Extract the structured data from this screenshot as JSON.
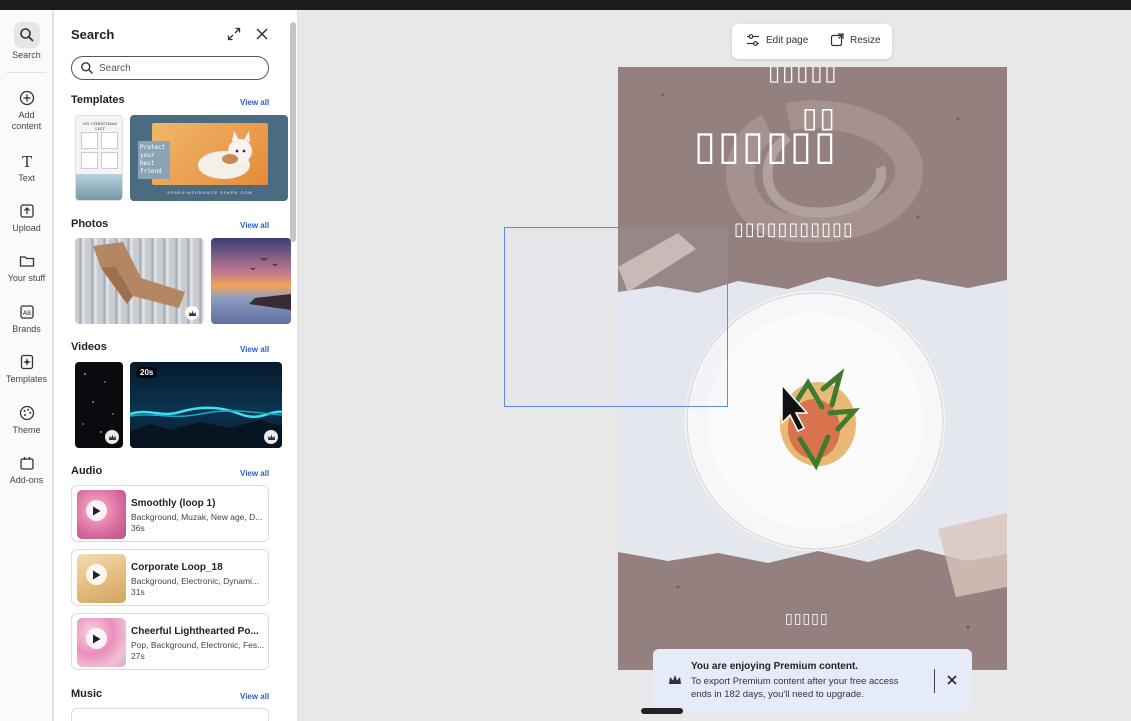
{
  "rail": {
    "items": [
      {
        "label": "Search",
        "icon": "search-icon"
      },
      {
        "label": "Add content",
        "icon": "plus-circle-icon"
      },
      {
        "label": "Text",
        "icon": "text-icon"
      },
      {
        "label": "Upload",
        "icon": "upload-icon"
      },
      {
        "label": "Your stuff",
        "icon": "folder-icon"
      },
      {
        "label": "Brands",
        "icon": "brand-icon"
      },
      {
        "label": "Templates",
        "icon": "templates-icon"
      },
      {
        "label": "Theme",
        "icon": "palette-icon"
      },
      {
        "label": "Add-ons",
        "icon": "addons-icon"
      }
    ]
  },
  "panel": {
    "title": "Search",
    "search_placeholder": "Search",
    "view_all": "View all",
    "sections": {
      "templates": "Templates",
      "photos": "Photos",
      "videos": "Videos",
      "audio": "Audio",
      "music": "Music"
    },
    "template_thumbs": [
      {
        "text": "MY CHRISTMAS LIST"
      },
      {
        "text": "Protect your best friend",
        "footer": "SPARKINSURANCE.SPARK.COM"
      }
    ],
    "video_badge": "20s",
    "audio": [
      {
        "title": "Smoothly (loop 1)",
        "tags": "Background, Muzak, New age, D...",
        "duration": "36s"
      },
      {
        "title": "Corporate Loop_18",
        "tags": "Background, Electronic, Dynami...",
        "duration": "31s"
      },
      {
        "title": "Cheerful Lighthearted Po...",
        "tags": "Pop, Background, Electronic, Fes...",
        "duration": "27s"
      }
    ]
  },
  "toolbar": {
    "edit_page": "Edit page",
    "resize": "Resize"
  },
  "canvas": {
    "line1": "▯▯▯▯▯",
    "line2": "▯▯",
    "line3": "▯▯▯▯▯▯",
    "line4": "▯▯▯▯▯▯▯▯▯▯▯",
    "footer": "▯▯▯▯▯"
  },
  "toast": {
    "title": "You are enjoying Premium content.",
    "body": "To export Premium content after your free access ends in 182 days, you'll need to upgrade."
  },
  "colors": {
    "page_bg": "#93807f",
    "accent": "#2c5fd1",
    "toast_bg": "#e6ebf9"
  }
}
